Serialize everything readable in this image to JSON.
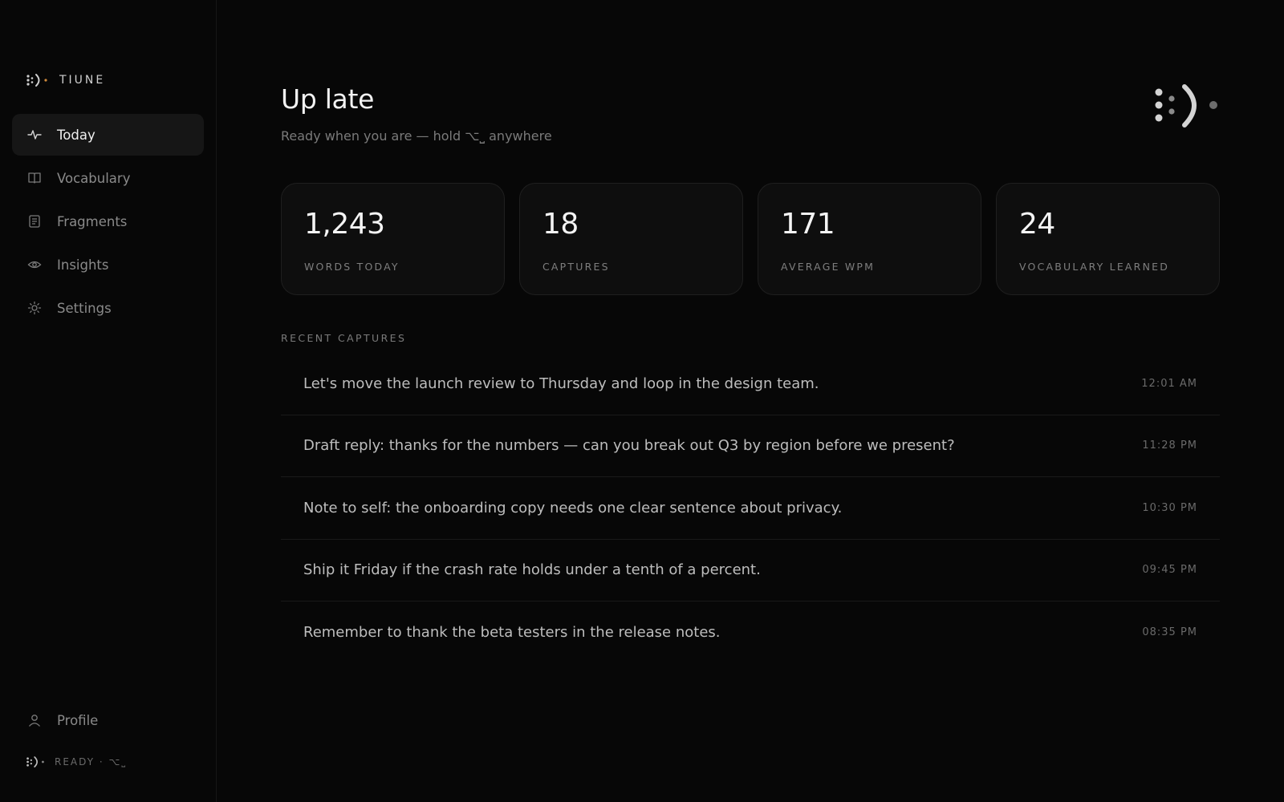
{
  "app": {
    "brand_name": "TIUNE"
  },
  "sidebar": {
    "items": [
      {
        "label": "Today",
        "icon": "activity-icon",
        "active": true
      },
      {
        "label": "Vocabulary",
        "icon": "book-icon",
        "active": false
      },
      {
        "label": "Fragments",
        "icon": "document-icon",
        "active": false
      },
      {
        "label": "Insights",
        "icon": "eye-icon",
        "active": false
      },
      {
        "label": "Settings",
        "icon": "gear-icon",
        "active": false
      }
    ],
    "profile_label": "Profile",
    "status_text": "READY · ⌥⎵"
  },
  "header": {
    "greeting": "Up late",
    "subtitle": "Ready when you are — hold ⌥⎵ anywhere"
  },
  "stats": [
    {
      "value": "1,243",
      "label": "WORDS TODAY"
    },
    {
      "value": "18",
      "label": "CAPTURES"
    },
    {
      "value": "171",
      "label": "AVERAGE WPM"
    },
    {
      "value": "24",
      "label": "VOCABULARY LEARNED"
    }
  ],
  "recent": {
    "title": "RECENT CAPTURES",
    "items": [
      {
        "text": "Let's move the launch review to Thursday and loop in the design team.",
        "time": "12:01 AM"
      },
      {
        "text": "Draft reply: thanks for the numbers — can you break out Q3 by region before we present?",
        "time": "11:28 PM"
      },
      {
        "text": "Note to self: the onboarding copy needs one clear sentence about privacy.",
        "time": "10:30 PM"
      },
      {
        "text": "Ship it Friday if the crash rate holds under a tenth of a percent.",
        "time": "09:45 PM"
      },
      {
        "text": "Remember to thank the beta testers in the release notes.",
        "time": "08:35 PM"
      }
    ]
  },
  "colors": {
    "background": "#070707",
    "accent": "#d08a3c",
    "card": "#0e0e0e"
  }
}
